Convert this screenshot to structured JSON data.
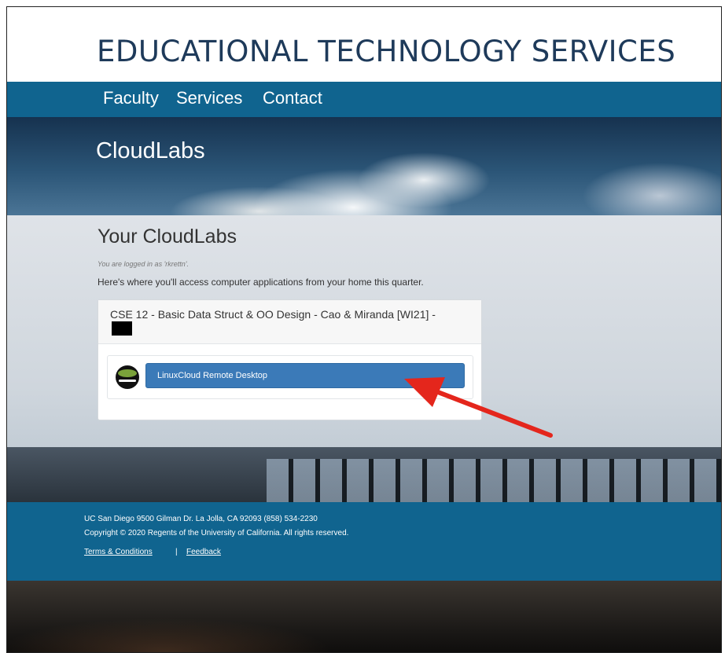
{
  "header": {
    "title": "EDUCATIONAL TECHNOLOGY SERVICES"
  },
  "nav": {
    "items": [
      {
        "label": "Faculty"
      },
      {
        "label": "Services"
      },
      {
        "label": "Contact"
      }
    ]
  },
  "hero": {
    "title": "CloudLabs"
  },
  "main": {
    "title": "Your CloudLabs",
    "login_note": "You are logged in as 'rkrettn'.",
    "intro": "Here's where you'll access computer applications from your home this quarter.",
    "course": {
      "title": "CSE 12 - Basic Data Struct & OO Design - Cao & Miranda [WI21] -",
      "app_label": "LinuxCloud Remote Desktop"
    }
  },
  "footer": {
    "address": "UC San Diego 9500 Gilman Dr. La Jolla, CA 92093 (858) 534-2230",
    "copyright": "Copyright © 2020 Regents of the University of California. All rights reserved.",
    "terms_label": "Terms & Conditions",
    "separator": "|",
    "feedback_label": "Feedback"
  },
  "colors": {
    "nav_blue": "#10648f",
    "title_navy": "#1e3a5a",
    "button_blue": "#3b7ab8",
    "arrow_red": "#e4261c"
  }
}
